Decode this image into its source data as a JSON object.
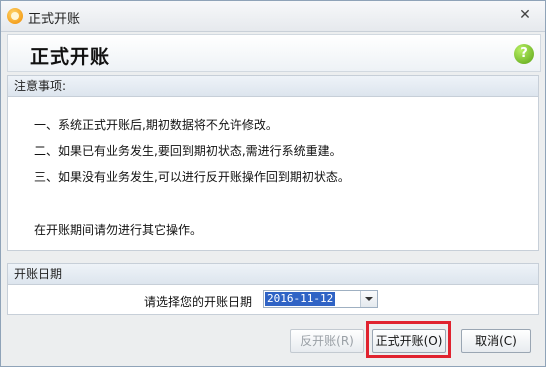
{
  "window": {
    "title": "正式开账"
  },
  "header": {
    "title": "正式开账"
  },
  "notes": {
    "heading": "注意事项:",
    "items": [
      "一、系统正式开账后,期初数据将不允许修改。",
      "二、如果已有业务发生,要回到期初状态,需进行系统重建。",
      "三、如果没有业务发生,可以进行反开账操作回到期初状态。"
    ],
    "footer": "在开账期间请勿进行其它操作。"
  },
  "date_section": {
    "heading": "开账日期",
    "label": "请选择您的开账日期",
    "value": "2016-11-12"
  },
  "buttons": {
    "reverse": "反开账(R)",
    "open": "正式开账(O)",
    "cancel": "取消(C)"
  },
  "colors": {
    "highlight": "#e0232f",
    "selection": "#2f63c5"
  },
  "icons": {
    "app": "app-logo-icon",
    "help": "help-icon",
    "close": "close-icon",
    "dropdown": "chevron-down-icon"
  }
}
